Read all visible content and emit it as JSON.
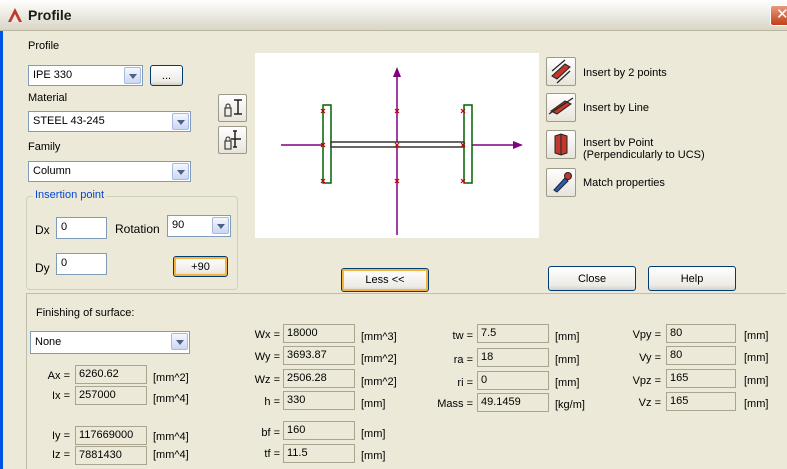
{
  "window": {
    "title": "Profile"
  },
  "profile": {
    "label": "Profile",
    "value": "IPE 330",
    "browse_label": "..."
  },
  "material": {
    "label": "Material",
    "value": "STEEL 43-245"
  },
  "family": {
    "label": "Family",
    "value": "Column"
  },
  "insertion": {
    "title": "Insertion point",
    "dx_label": "Dx",
    "dx_value": "0",
    "dy_label": "Dy",
    "dy_value": "0",
    "rotation_label": "Rotation",
    "rotation_value": "90",
    "plus90_label": "+90"
  },
  "actions": {
    "insert_2_points": "Insert by 2 points",
    "insert_line": "Insert by Line",
    "insert_point_1": "Insert bv Point",
    "insert_point_2": "(Perpendicularly to UCS)",
    "match": "Match properties"
  },
  "buttons": {
    "less": "Less <<",
    "close": "Close",
    "help": "Help"
  },
  "finishing": {
    "label": "Finishing of surface:",
    "value": "None"
  },
  "props": {
    "col1": [
      {
        "label": "Ax =",
        "value": "6260.62",
        "unit": "[mm^2]"
      },
      {
        "label": "Ix =",
        "value": "257000",
        "unit": "[mm^4]"
      },
      {
        "label": "Iy =",
        "value": "117669000",
        "unit": "[mm^4]"
      },
      {
        "label": "Iz =",
        "value": "7881430",
        "unit": "[mm^4]"
      }
    ],
    "col2": [
      {
        "label": "Wx =",
        "value": "18000",
        "unit": "[mm^3]"
      },
      {
        "label": "Wy =",
        "value": "3693.87",
        "unit": "[mm^2]"
      },
      {
        "label": "Wz =",
        "value": "2506.28",
        "unit": "[mm^2]"
      },
      {
        "label": "h =",
        "value": "330",
        "unit": "[mm]"
      },
      {
        "label": "bf =",
        "value": "160",
        "unit": "[mm]"
      },
      {
        "label": "tf =",
        "value": "11.5",
        "unit": "[mm]"
      }
    ],
    "col3": [
      {
        "label": "tw =",
        "value": "7.5",
        "unit": "[mm]"
      },
      {
        "label": "ra =",
        "value": "18",
        "unit": "[mm]"
      },
      {
        "label": "ri =",
        "value": "0",
        "unit": "[mm]"
      },
      {
        "label": "Mass =",
        "value": "49.1459",
        "unit": "[kg/m]"
      }
    ],
    "col4": [
      {
        "label": "Vpy =",
        "value": "80",
        "unit": "[mm]"
      },
      {
        "label": "Vy =",
        "value": "80",
        "unit": "[mm]"
      },
      {
        "label": "Vpz =",
        "value": "165",
        "unit": "[mm]"
      },
      {
        "label": "Vz =",
        "value": "165",
        "unit": "[mm]"
      }
    ]
  }
}
